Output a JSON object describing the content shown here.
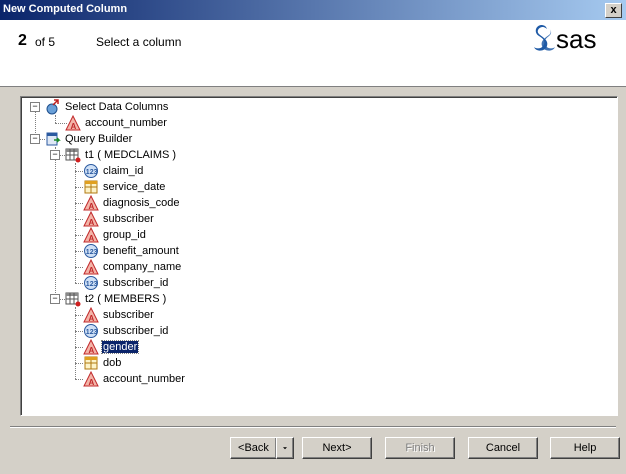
{
  "window": {
    "title": "New Computed Column",
    "close_label": "x"
  },
  "header": {
    "step_number": "2",
    "step_of": "of 5",
    "step_title": "Select a column",
    "logo_text": "sas"
  },
  "tree": {
    "root1": {
      "label": "Select Data Columns",
      "children": [
        "account_number"
      ]
    },
    "root2": {
      "label": "Query Builder"
    },
    "table1": {
      "label": "t1 ( MEDCLAIMS )",
      "columns": [
        {
          "label": "claim_id",
          "type": "numeric"
        },
        {
          "label": "service_date",
          "type": "date"
        },
        {
          "label": "diagnosis_code",
          "type": "character"
        },
        {
          "label": "subscriber",
          "type": "character"
        },
        {
          "label": "group_id",
          "type": "character"
        },
        {
          "label": "benefit_amount",
          "type": "numeric"
        },
        {
          "label": "company_name",
          "type": "character"
        },
        {
          "label": "subscriber_id",
          "type": "numeric"
        }
      ]
    },
    "table2": {
      "label": "t2 ( MEMBERS )",
      "columns": [
        {
          "label": "subscriber",
          "type": "character"
        },
        {
          "label": "subscriber_id",
          "type": "numeric"
        },
        {
          "label": "gender",
          "type": "character",
          "selected": true
        },
        {
          "label": "dob",
          "type": "date"
        },
        {
          "label": "account_number",
          "type": "character"
        }
      ]
    }
  },
  "buttons": {
    "back": "<Back",
    "next": "Next>",
    "finish": "Finish",
    "cancel": "Cancel",
    "help": "Help"
  },
  "colors": {
    "title_start": "#0a246a",
    "title_end": "#a6caf0",
    "selection": "#0a246a",
    "sas_blue": "#1f5aa6"
  }
}
